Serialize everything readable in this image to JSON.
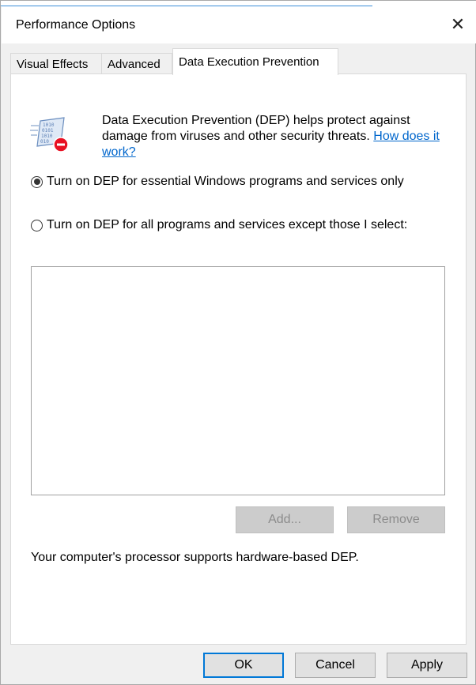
{
  "window": {
    "title": "Performance Options"
  },
  "tabs": [
    {
      "label": "Visual Effects"
    },
    {
      "label": "Advanced"
    },
    {
      "label": "Data Execution Prevention"
    }
  ],
  "dep": {
    "description": "Data Execution Prevention (DEP) helps protect against damage from viruses and other security threats.",
    "link": "How does it work?",
    "options": [
      {
        "label": "Turn on DEP for essential Windows programs and services only",
        "selected": true
      },
      {
        "label": "Turn on DEP for all programs and services except those I select:",
        "selected": false
      }
    ],
    "add_label": "Add...",
    "remove_label": "Remove",
    "support_text": "Your computer's processor supports hardware-based DEP."
  },
  "footer": {
    "ok": "OK",
    "cancel": "Cancel",
    "apply": "Apply"
  },
  "colors": {
    "accent": "#0078d7",
    "link": "#0066cc",
    "icon_badge": "#e81123"
  },
  "icons": [
    "close-icon",
    "dep-shield-icon"
  ]
}
